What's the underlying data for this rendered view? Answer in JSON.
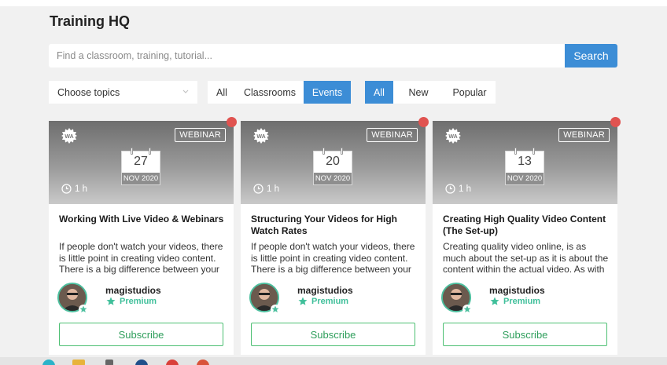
{
  "header": {
    "title": "Training HQ"
  },
  "search": {
    "placeholder": "Find a classroom, training, tutorial...",
    "button_label": "Search"
  },
  "filters": {
    "topic_select": "Choose topics",
    "type_tabs": [
      {
        "label": "All",
        "active": false
      },
      {
        "label": "Classrooms",
        "active": false
      },
      {
        "label": "Events",
        "active": true
      }
    ],
    "sort_tabs": [
      {
        "label": "All",
        "active": true
      },
      {
        "label": "New",
        "active": false
      },
      {
        "label": "Popular",
        "active": false
      }
    ]
  },
  "cards": [
    {
      "badge": "WEBINAR",
      "day": "27",
      "month": "NOV 2020",
      "duration": "1 h",
      "title": "Working With Live Video & Webinars",
      "description": "If people don't watch your videos, there is little point in creating video content. There is a big difference between your expectations with",
      "author": "magistudios",
      "tier": "Premium",
      "subscribe_label": "Subscribe"
    },
    {
      "badge": "WEBINAR",
      "day": "20",
      "month": "NOV 2020",
      "duration": "1 h",
      "title": "Structuring Your Videos for High Watch Rates",
      "description": "If people don't watch your videos, there is little point in creating video content. There is a big difference between your expectations with",
      "author": "magistudios",
      "tier": "Premium",
      "subscribe_label": "Subscribe"
    },
    {
      "badge": "WEBINAR",
      "day": "13",
      "month": "NOV 2020",
      "duration": "1 h",
      "title": "Creating High Quality Video Content (The Set-up)",
      "description": "Creating quality video online, is as much about the set-up as it is about the content within the actual video. As with any skill, having a clear plan",
      "author": "magistudios",
      "tier": "Premium",
      "subscribe_label": "Subscribe"
    }
  ],
  "colors": {
    "accent": "#3c8dd6",
    "live_dot": "#e05350",
    "premium": "#3fbf9a",
    "subscribe": "#4cbf72"
  }
}
